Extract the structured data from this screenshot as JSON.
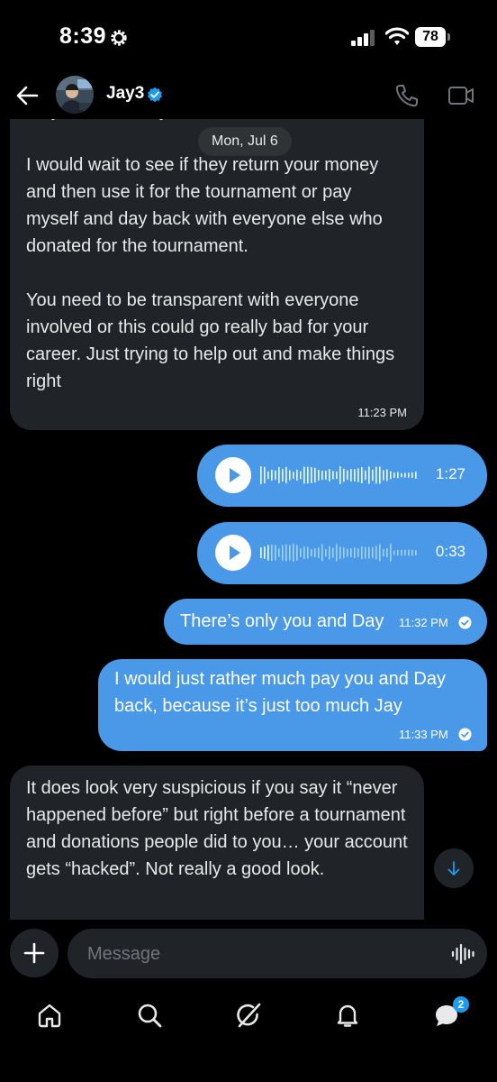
{
  "status_bar": {
    "time": "8:39",
    "battery": "78"
  },
  "header": {
    "contact_name": "Jay3"
  },
  "chat": {
    "date_divider": "Mon, Jul 6",
    "incoming_1": {
      "text": "they take it from you\n\nI would wait to see if they return your money and then use it for the tournament or pay myself and day back with everyone else who donated for the tournament.\n\nYou need to be transparent with everyone involved or this could go really bad for your career. Just trying to help out and make things right",
      "time": "11:23 PM"
    },
    "voice_1": {
      "duration": "1:27",
      "progress": 1.0
    },
    "voice_2": {
      "duration": "0:33",
      "progress": 0.05
    },
    "outgoing_1": {
      "text": "There’s only you and Day",
      "time": "11:32 PM"
    },
    "outgoing_2": {
      "text": "I would just rather much pay you and Day back, because it’s just too much Jay",
      "time": "11:33 PM"
    },
    "incoming_2": {
      "text": "It does look very suspicious if you say it “never happened before” but right before a tournament and donations people did to you… your account gets “hacked”. Not really a good look."
    }
  },
  "composer": {
    "placeholder": "Message"
  },
  "tabbar": {
    "messages_badge": "2"
  },
  "colors": {
    "outgoing_bubble": "#4a99e9",
    "incoming_bubble": "#202327",
    "accent": "#1d9bf0",
    "background": "#000000"
  }
}
